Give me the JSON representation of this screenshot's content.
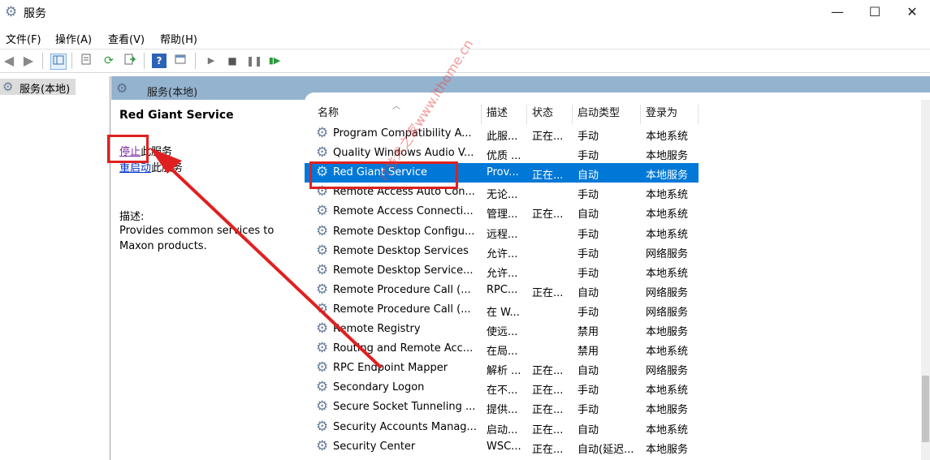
{
  "window": {
    "title": "服务",
    "minimize_glyph": "—",
    "maximize_glyph": "☐",
    "close_glyph": "✕"
  },
  "menu": [
    "文件(F)",
    "操作(A)",
    "查看(V)",
    "帮助(H)"
  ],
  "toolbar_icons": [
    "back-arrow-icon",
    "forward-arrow-icon",
    "console-tree-icon",
    "properties-icon",
    "refresh-icon",
    "export-list-icon",
    "help-icon",
    "console-view-icon",
    "start-service-icon",
    "stop-service-icon",
    "pause-service-icon",
    "resume-service-icon"
  ],
  "tree": {
    "root_label": "服务(本地)"
  },
  "main_header": {
    "label": "服务(本地)"
  },
  "detail": {
    "service_name": "Red Giant Service",
    "action1_link": "停止",
    "action1_suffix": "此服务",
    "action2_link": "重启动",
    "action2_suffix": "此服务",
    "desc_label": "描述:",
    "desc_text": "Provides common services to Maxon products."
  },
  "columns": [
    "名称",
    "描述",
    "状态",
    "启动类型",
    "登录为"
  ],
  "rows": [
    {
      "name": "Program Compatibility A...",
      "desc": "此服...",
      "status": "正在...",
      "startup": "手动",
      "logon": "本地系统"
    },
    {
      "name": "Quality Windows Audio V...",
      "desc": "优质 ...",
      "status": "",
      "startup": "手动",
      "logon": "本地服务"
    },
    {
      "name": "Red Giant Service",
      "desc": "Prov...",
      "status": "正在...",
      "startup": "自动",
      "logon": "本地服务"
    },
    {
      "name": "Remote Access Auto Con...",
      "desc": "无论...",
      "status": "",
      "startup": "手动",
      "logon": "本地系统"
    },
    {
      "name": "Remote Access Connecti...",
      "desc": "管理...",
      "status": "正在...",
      "startup": "自动",
      "logon": "本地系统"
    },
    {
      "name": "Remote Desktop Configu...",
      "desc": "远程...",
      "status": "",
      "startup": "手动",
      "logon": "本地系统"
    },
    {
      "name": "Remote Desktop Services",
      "desc": "允许...",
      "status": "",
      "startup": "手动",
      "logon": "网络服务"
    },
    {
      "name": "Remote Desktop Service...",
      "desc": "允许...",
      "status": "",
      "startup": "手动",
      "logon": "本地系统"
    },
    {
      "name": "Remote Procedure Call (...",
      "desc": "RPC...",
      "status": "正在...",
      "startup": "自动",
      "logon": "网络服务"
    },
    {
      "name": "Remote Procedure Call (...",
      "desc": "在 W...",
      "status": "",
      "startup": "手动",
      "logon": "网络服务"
    },
    {
      "name": "Remote Registry",
      "desc": "使远...",
      "status": "",
      "startup": "禁用",
      "logon": "本地服务"
    },
    {
      "name": "Routing and Remote Acc...",
      "desc": "在局...",
      "status": "",
      "startup": "禁用",
      "logon": "本地系统"
    },
    {
      "name": "RPC Endpoint Mapper",
      "desc": "解析 ...",
      "status": "正在...",
      "startup": "自动",
      "logon": "网络服务"
    },
    {
      "name": "Secondary Logon",
      "desc": "在不...",
      "status": "正在...",
      "startup": "手动",
      "logon": "本地系统"
    },
    {
      "name": "Secure Socket Tunneling ...",
      "desc": "提供...",
      "status": "正在...",
      "startup": "手动",
      "logon": "本地服务"
    },
    {
      "name": "Security Accounts Manag...",
      "desc": "启动...",
      "status": "正在...",
      "startup": "自动",
      "logon": "本地系统"
    },
    {
      "name": "Security Center",
      "desc": "WSC...",
      "status": "正在...",
      "startup": "自动(延迟...",
      "logon": "本地服务"
    }
  ],
  "selected_row_index": 2,
  "watermark": "IT技术之家www.ithome.cn",
  "colors": {
    "selection": "#0078d7",
    "header_bar": "#94b3cf",
    "annotation_red": "#e02020",
    "visited_link": "#7a2ba5"
  }
}
